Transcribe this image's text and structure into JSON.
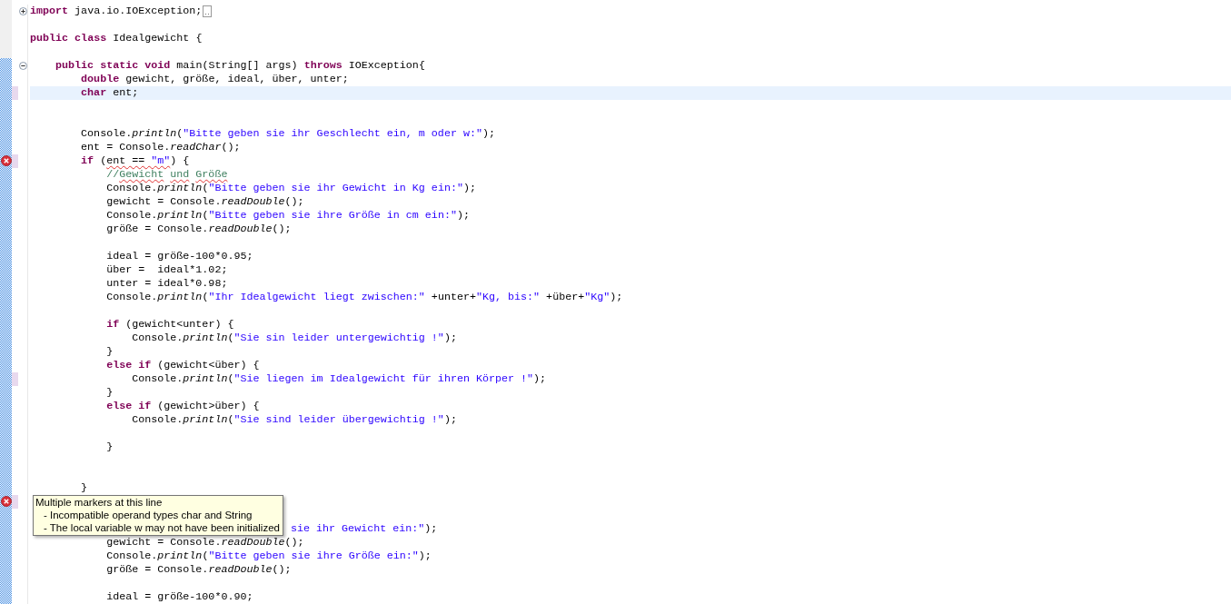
{
  "lines": [
    {
      "kind": "code",
      "collapsed": true,
      "folded_import": true,
      "segments": [
        {
          "kind": "kw",
          "text": "import"
        },
        {
          "kind": "plain",
          "text": " java.io.IOException;"
        }
      ]
    },
    {
      "kind": "blank"
    },
    {
      "kind": "code",
      "segments": [
        {
          "kind": "kw",
          "text": "public "
        },
        {
          "kind": "kw",
          "text": "class"
        },
        {
          "kind": "plain",
          "text": " Idealgewicht {"
        }
      ],
      "children": [
        {
          "kind": "blank"
        },
        {
          "kind": "code",
          "collapsed": false,
          "segments": [
            {
              "kind": "kw",
              "text": "public "
            },
            {
              "kind": "kw",
              "text": "static "
            },
            {
              "kind": "kw",
              "text": "void"
            },
            {
              "kind": "plain",
              "text": " main(String[] args) "
            },
            {
              "kind": "kw",
              "text": "throws"
            },
            {
              "kind": "plain",
              "text": " IOException{"
            }
          ],
          "children": [
            {
              "kind": "code",
              "segments": [
                {
                  "kind": "kw",
                  "text": "double"
                },
                {
                  "kind": "plain",
                  "text": " gewicht, größe, ideal, über, unter;"
                }
              ]
            },
            {
              "kind": "code",
              "changed": true,
              "current": true,
              "segments": [
                {
                  "kind": "kw",
                  "text": "char"
                },
                {
                  "kind": "plain",
                  "text": " ent;"
                }
              ]
            },
            {
              "kind": "blank"
            },
            {
              "kind": "blank"
            },
            {
              "kind": "code",
              "segments": [
                {
                  "kind": "plain",
                  "text": "Console."
                },
                {
                  "kind": "method",
                  "text": "println"
                },
                {
                  "kind": "plain",
                  "text": "("
                },
                {
                  "kind": "str",
                  "text": "\"Bitte geben sie ihr Geschlecht ein, m oder w:\""
                },
                {
                  "kind": "plain",
                  "text": ");"
                }
              ]
            },
            {
              "kind": "code",
              "segments": [
                {
                  "kind": "plain",
                  "text": "ent = Console."
                },
                {
                  "kind": "method",
                  "text": "readChar"
                },
                {
                  "kind": "plain",
                  "text": "();"
                }
              ]
            },
            {
              "kind": "code",
              "error": true,
              "changed": true,
              "segments": [
                {
                  "kind": "kw",
                  "text": "if"
                },
                {
                  "kind": "plain",
                  "text": " ("
                },
                {
                  "kind": "plain",
                  "squiggle": true,
                  "text": "ent == "
                },
                {
                  "kind": "str",
                  "squiggle": true,
                  "text": "\"m\""
                },
                {
                  "kind": "plain",
                  "text": ") {"
                }
              ],
              "children": [
                {
                  "kind": "code",
                  "segments": [
                    {
                      "kind": "comment",
                      "text": "//"
                    },
                    {
                      "kind": "comment",
                      "squiggle": true,
                      "text": "Gewicht"
                    },
                    {
                      "kind": "comment",
                      "squiggle": true,
                      "gap_before": true,
                      "text": "und"
                    },
                    {
                      "kind": "comment",
                      "squiggle": true,
                      "gap_before": true,
                      "text": "Größe"
                    }
                  ]
                },
                {
                  "kind": "code",
                  "segments": [
                    {
                      "kind": "plain",
                      "text": "Console."
                    },
                    {
                      "kind": "method",
                      "text": "println"
                    },
                    {
                      "kind": "plain",
                      "text": "("
                    },
                    {
                      "kind": "str",
                      "text": "\"Bitte geben sie ihr Gewicht in Kg ein:\""
                    },
                    {
                      "kind": "plain",
                      "text": ");"
                    }
                  ]
                },
                {
                  "kind": "code",
                  "segments": [
                    {
                      "kind": "plain",
                      "text": "gewicht = Console."
                    },
                    {
                      "kind": "method",
                      "text": "readDouble"
                    },
                    {
                      "kind": "plain",
                      "text": "();"
                    }
                  ]
                },
                {
                  "kind": "code",
                  "segments": [
                    {
                      "kind": "plain",
                      "text": "Console."
                    },
                    {
                      "kind": "method",
                      "text": "println"
                    },
                    {
                      "kind": "plain",
                      "text": "("
                    },
                    {
                      "kind": "str",
                      "text": "\"Bitte geben sie ihre Größe in cm ein:\""
                    },
                    {
                      "kind": "plain",
                      "text": ");"
                    }
                  ]
                },
                {
                  "kind": "code",
                  "segments": [
                    {
                      "kind": "plain",
                      "text": "größe = Console."
                    },
                    {
                      "kind": "method",
                      "text": "readDouble"
                    },
                    {
                      "kind": "plain",
                      "text": "();"
                    }
                  ]
                },
                {
                  "kind": "blank"
                },
                {
                  "kind": "code",
                  "segments": [
                    {
                      "kind": "plain",
                      "text": "ideal = größe-100*0.95;"
                    }
                  ]
                },
                {
                  "kind": "code",
                  "segments": [
                    {
                      "kind": "plain",
                      "text": "über =  ideal*1.02;"
                    }
                  ]
                },
                {
                  "kind": "code",
                  "segments": [
                    {
                      "kind": "plain",
                      "text": "unter = ideal*0.98;"
                    }
                  ]
                },
                {
                  "kind": "code",
                  "segments": [
                    {
                      "kind": "plain",
                      "text": "Console."
                    },
                    {
                      "kind": "method",
                      "text": "println"
                    },
                    {
                      "kind": "plain",
                      "text": "("
                    },
                    {
                      "kind": "str",
                      "text": "\"Ihr Idealgewicht liegt zwischen:\""
                    },
                    {
                      "kind": "plain",
                      "text": " +unter+"
                    },
                    {
                      "kind": "str",
                      "text": "\"Kg, bis:\""
                    },
                    {
                      "kind": "plain",
                      "text": " +über+"
                    },
                    {
                      "kind": "str",
                      "text": "\"Kg\""
                    },
                    {
                      "kind": "plain",
                      "text": ");"
                    }
                  ]
                },
                {
                  "kind": "blank"
                },
                {
                  "kind": "code",
                  "segments": [
                    {
                      "kind": "kw",
                      "text": "if"
                    },
                    {
                      "kind": "plain",
                      "text": " (gewicht<unter) {"
                    }
                  ],
                  "children": [
                    {
                      "kind": "code",
                      "segments": [
                        {
                          "kind": "plain",
                          "text": "Console."
                        },
                        {
                          "kind": "method",
                          "text": "println"
                        },
                        {
                          "kind": "plain",
                          "text": "("
                        },
                        {
                          "kind": "str",
                          "text": "\"Sie sin leider untergewichtig !\""
                        },
                        {
                          "kind": "plain",
                          "text": ");"
                        }
                      ]
                    }
                  ]
                },
                {
                  "kind": "code",
                  "segments": [
                    {
                      "kind": "plain",
                      "text": "}"
                    }
                  ]
                },
                {
                  "kind": "code",
                  "segments": [
                    {
                      "kind": "kw",
                      "text": "else "
                    },
                    {
                      "kind": "kw",
                      "text": "if"
                    },
                    {
                      "kind": "plain",
                      "text": " (gewicht<über) {"
                    }
                  ],
                  "children": [
                    {
                      "kind": "code",
                      "changed": true,
                      "segments": [
                        {
                          "kind": "plain",
                          "text": "Console."
                        },
                        {
                          "kind": "method",
                          "text": "println"
                        },
                        {
                          "kind": "plain",
                          "text": "("
                        },
                        {
                          "kind": "str",
                          "text": "\"Sie liegen im Idealgewicht für ihren Körper !\""
                        },
                        {
                          "kind": "plain",
                          "text": ");"
                        }
                      ]
                    }
                  ]
                },
                {
                  "kind": "code",
                  "segments": [
                    {
                      "kind": "plain",
                      "text": "}"
                    }
                  ]
                },
                {
                  "kind": "code",
                  "segments": [
                    {
                      "kind": "kw",
                      "text": "else "
                    },
                    {
                      "kind": "kw",
                      "text": "if"
                    },
                    {
                      "kind": "plain",
                      "text": " (gewicht>über) {"
                    }
                  ],
                  "children": [
                    {
                      "kind": "code",
                      "segments": [
                        {
                          "kind": "plain",
                          "text": "Console."
                        },
                        {
                          "kind": "method",
                          "text": "println"
                        },
                        {
                          "kind": "plain",
                          "text": "("
                        },
                        {
                          "kind": "str",
                          "text": "\"Sie sind leider übergewichtig !\""
                        },
                        {
                          "kind": "plain",
                          "text": ");"
                        }
                      ]
                    },
                    {
                      "kind": "blank"
                    }
                  ]
                },
                {
                  "kind": "code",
                  "segments": [
                    {
                      "kind": "plain",
                      "text": "}"
                    }
                  ]
                },
                {
                  "kind": "blank"
                },
                {
                  "kind": "blank"
                }
              ]
            },
            {
              "kind": "code",
              "segments": [
                {
                  "kind": "plain",
                  "text": "}"
                }
              ]
            },
            {
              "kind": "hidden",
              "error": true,
              "changed": true,
              "children": [
                {
                  "kind": "hidden"
                },
                {
                  "kind": "clipped",
                  "segments": [
                    {
                      "kind": "str",
                      "text": "sie ihr Gewicht ein:\""
                    },
                    {
                      "kind": "plain",
                      "text": ");"
                    }
                  ]
                },
                {
                  "kind": "code",
                  "segments": [
                    {
                      "kind": "plain",
                      "text": "gewicht = Console."
                    },
                    {
                      "kind": "method",
                      "text": "readDouble"
                    },
                    {
                      "kind": "plain",
                      "text": "();"
                    }
                  ]
                },
                {
                  "kind": "code",
                  "segments": [
                    {
                      "kind": "plain",
                      "text": "Console."
                    },
                    {
                      "kind": "method",
                      "text": "println"
                    },
                    {
                      "kind": "plain",
                      "text": "("
                    },
                    {
                      "kind": "str",
                      "text": "\"Bitte geben sie ihre Größe ein:\""
                    },
                    {
                      "kind": "plain",
                      "text": ");"
                    }
                  ]
                },
                {
                  "kind": "code",
                  "segments": [
                    {
                      "kind": "plain",
                      "text": "größe = Console."
                    },
                    {
                      "kind": "method",
                      "text": "readDouble"
                    },
                    {
                      "kind": "plain",
                      "text": "();"
                    }
                  ]
                },
                {
                  "kind": "blank"
                },
                {
                  "kind": "code",
                  "segments": [
                    {
                      "kind": "plain",
                      "text": "ideal = größe-100*0.90;"
                    }
                  ]
                }
              ]
            }
          ]
        }
      ]
    }
  ],
  "tooltip": {
    "title": "Multiple markers at this line",
    "messages": [
      "- Incompatible operand types char and String",
      "- The local variable w may not have been initialized"
    ]
  }
}
